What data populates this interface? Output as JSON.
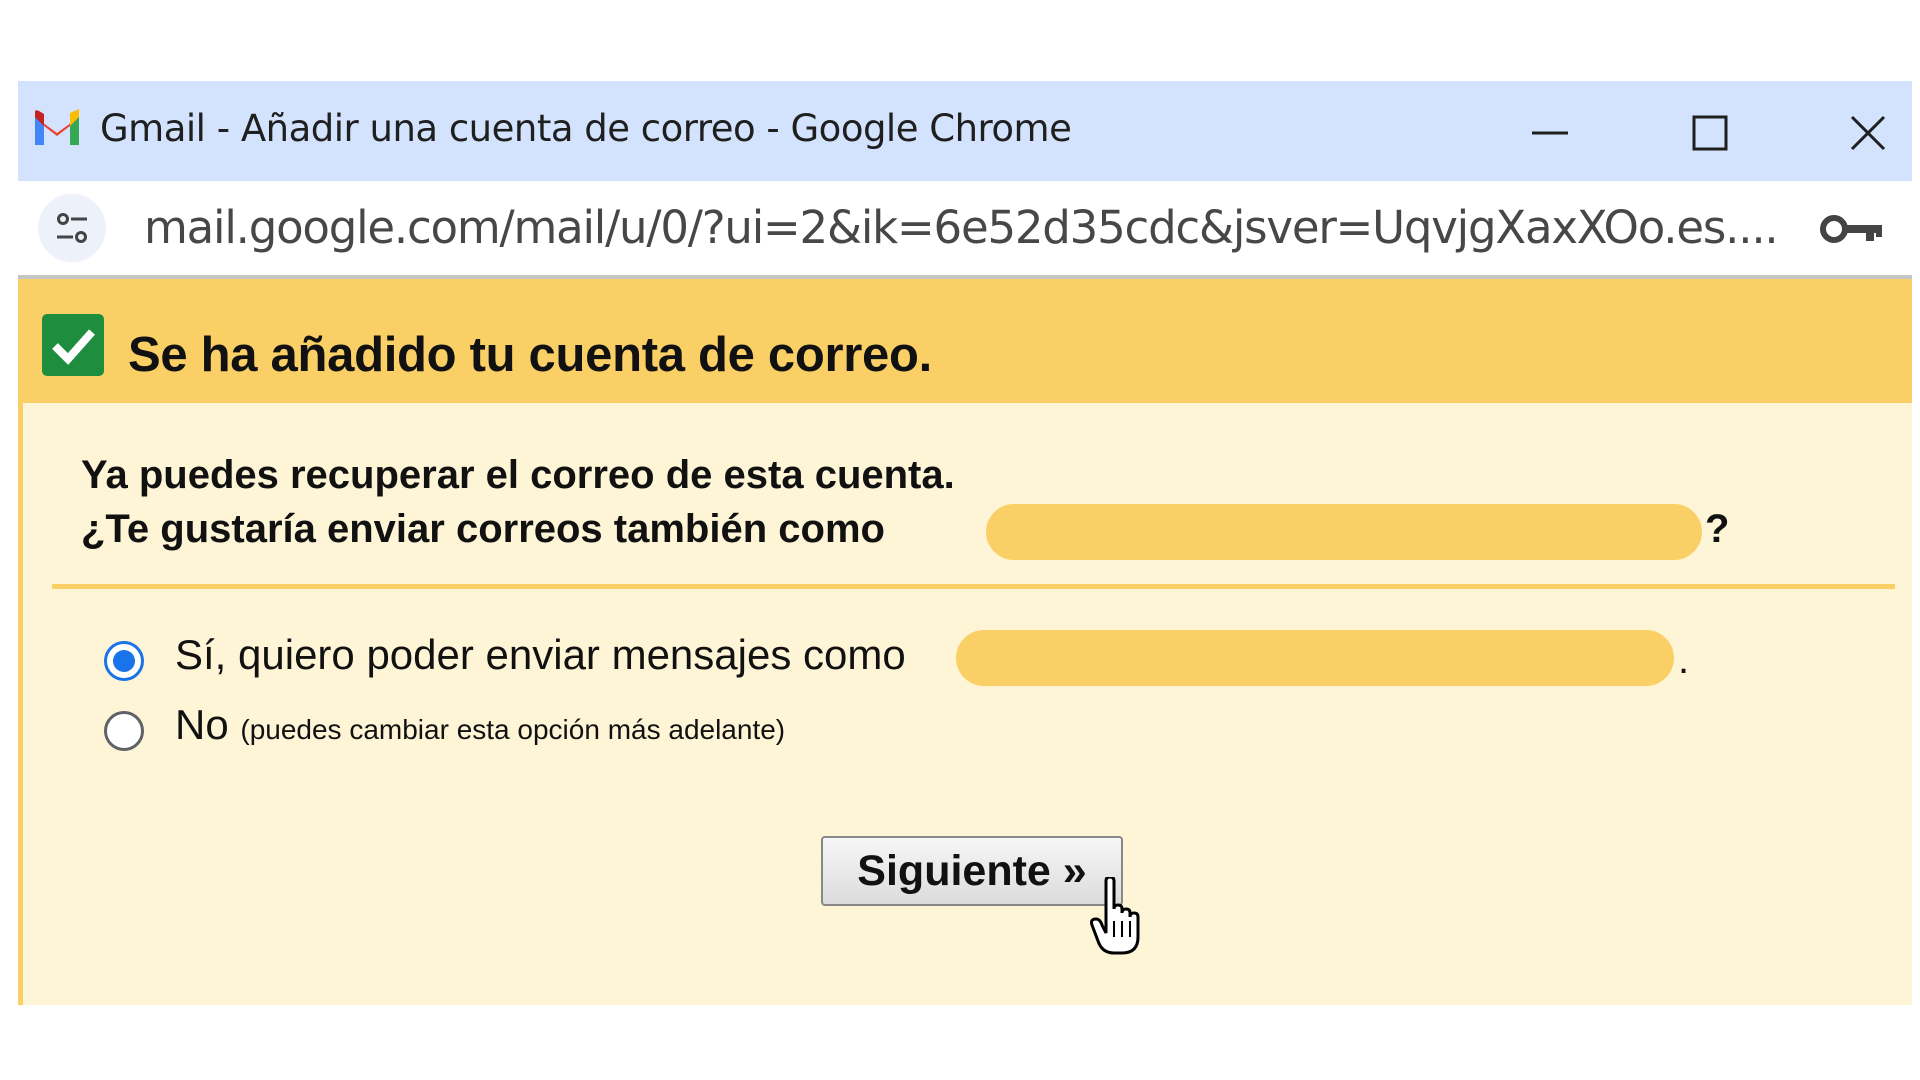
{
  "window": {
    "title": "Gmail - Añadir una cuenta de correo - Google Chrome",
    "logo_icon": "gmail-logo",
    "controls": {
      "minimize_icon": "minimize-icon",
      "maximize_icon": "maximize-icon",
      "close_icon": "close-icon"
    }
  },
  "addressbar": {
    "site_info_icon": "tune-icon",
    "url": "mail.google.com/mail/u/0/?ui=2&ik=6e52d35cdc&jsver=UqvjgXaxXOo.es....",
    "password_icon": "key-icon"
  },
  "banner": {
    "icon": "checkbox-check-icon",
    "title": "Se ha añadido tu cuenta de correo."
  },
  "message": {
    "line1": "Ya puedes recuperar el correo de esta cuenta.",
    "line2": "¿Te gustaría enviar correos también como",
    "line2_end": "?"
  },
  "options": {
    "yes_label": "Sí, quiero poder enviar mensajes como",
    "yes_end": ".",
    "yes_selected": true,
    "no_label": "No",
    "no_note": "(puedes cambiar esta opción más adelante)",
    "no_selected": false
  },
  "next_button": {
    "label": "Siguiente »"
  },
  "colors": {
    "titlebar": "#d3e3fd",
    "banner": "#f9cf66",
    "content_bg": "#fef4d6",
    "radio_accent": "#1a73e8"
  }
}
